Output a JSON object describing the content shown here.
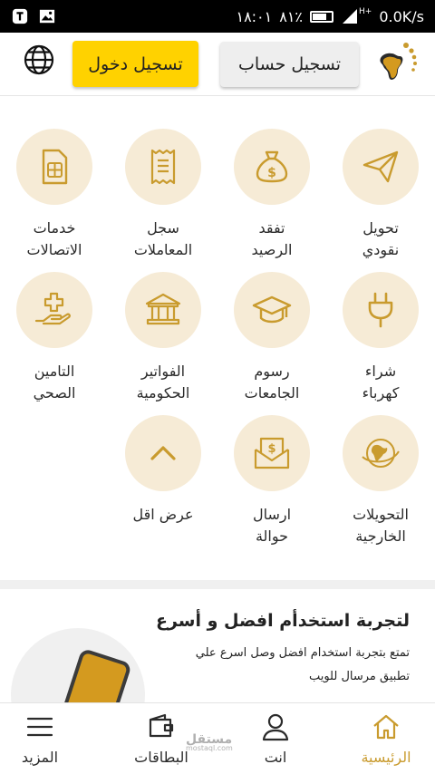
{
  "status_bar": {
    "time": "١٨:٠١",
    "battery_pct": "٨١٪",
    "speed": "0.0K/s",
    "network": "H+"
  },
  "header": {
    "login_label": "تسجيل دخول",
    "register_label": "تسجيل حساب"
  },
  "services": [
    {
      "label": "تحويل\nنقودي",
      "icon": "paper-plane-icon"
    },
    {
      "label": "تفقد\nالرصيد",
      "icon": "money-bag-icon"
    },
    {
      "label": "سجل\nالمعاملات",
      "icon": "receipt-icon"
    },
    {
      "label": "خدمات\nالاتصالات",
      "icon": "sim-card-icon"
    },
    {
      "label": "شراء\nكهرباء",
      "icon": "plug-icon"
    },
    {
      "label": "رسوم\nالجامعات",
      "icon": "graduation-cap-icon"
    },
    {
      "label": "الفواتير\nالحكومية",
      "icon": "government-building-icon"
    },
    {
      "label": "التامين\nالصحي",
      "icon": "health-hand-icon"
    },
    {
      "label": "التحويلات\nالخارجية",
      "icon": "globe-transfer-icon"
    },
    {
      "label": "ارسال\nحوالة",
      "icon": "money-envelope-icon"
    },
    {
      "label": "عرض اقل",
      "icon": "chevron-up-icon"
    }
  ],
  "promo": {
    "title": "لتجربة استخدأم افضل و أسرع",
    "text": "تمتع بتجربة استخدام افضل وصل اسرع علي تطبيق مرسال للويب"
  },
  "bottom_nav": [
    {
      "label": "الرئيسية",
      "icon": "home-icon",
      "active": true
    },
    {
      "label": "انت",
      "icon": "user-icon",
      "active": false
    },
    {
      "label": "البطاقات",
      "icon": "wallet-icon",
      "active": false
    },
    {
      "label": "المزيد",
      "icon": "menu-icon",
      "active": false
    }
  ],
  "watermark": {
    "text": "مستقل",
    "sub": "mostaql.com"
  },
  "colors": {
    "accent": "#c99b2e",
    "circle_bg": "#f6ebd6",
    "login_bg": "#ffd200"
  }
}
